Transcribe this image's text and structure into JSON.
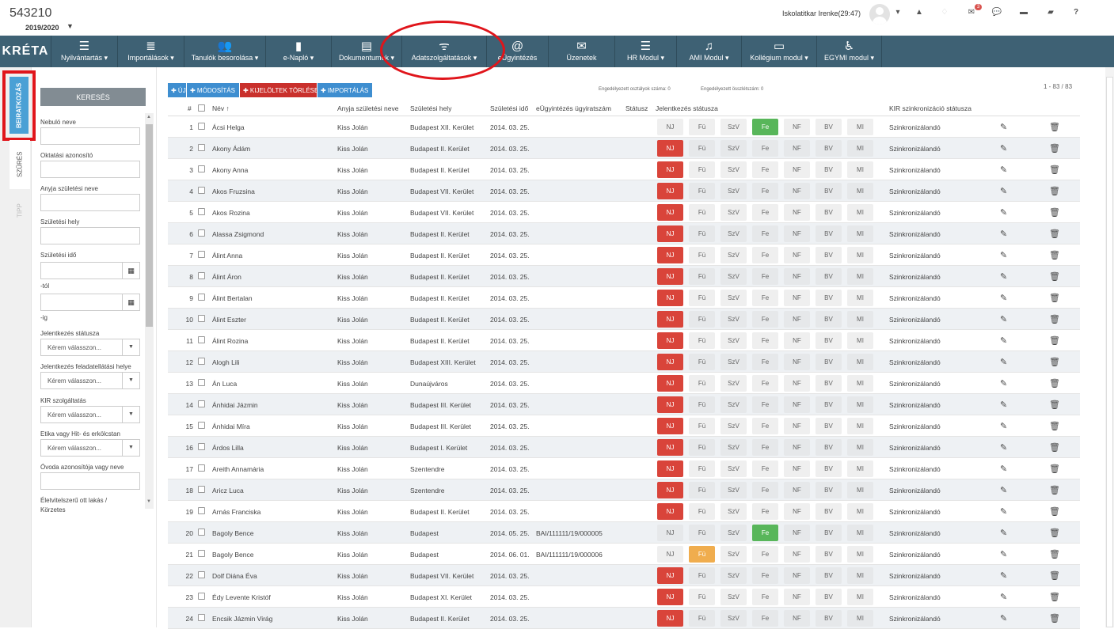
{
  "header": {
    "institution_code": "543210",
    "school_year": "2019/2020",
    "year_caret": "▼",
    "user_name": "Iskolatitkar Irenke(29:47)",
    "user_caret": "▾",
    "icons": {
      "warning": "▲",
      "bell": "♢",
      "mail": "✉",
      "chat": "💬",
      "card": "▬",
      "book": "▰",
      "help": "?"
    },
    "mail_badge": "3"
  },
  "nav": {
    "logo": "KRÉTA",
    "items": [
      {
        "label": "Nyilvántartás ▾",
        "icon": "☰"
      },
      {
        "label": "Importálások ▾",
        "icon": "≣"
      },
      {
        "label": "Tanulók besorolása ▾",
        "icon": "👥"
      },
      {
        "label": "e-Napló ▾",
        "icon": "▮"
      },
      {
        "label": "Dokumentumok ▾",
        "icon": "▤"
      },
      {
        "label": "Adatszolgáltatások ▾",
        "icon": "ᯤ"
      },
      {
        "label": "eÜgyintézés",
        "icon": "@"
      },
      {
        "label": "Üzenetek",
        "icon": "✉"
      },
      {
        "label": "HR Modul ▾",
        "icon": "☰"
      },
      {
        "label": "AMI Modul ▾",
        "icon": "♫"
      },
      {
        "label": "Kollégium modul ▾",
        "icon": "▭"
      },
      {
        "label": "EGYMI modul ▾",
        "icon": "♿"
      }
    ]
  },
  "side_tabs": {
    "beiratkozas": "BEIRATKOZÁS",
    "szures": "SZŰRÉS",
    "tipp": "TIPP"
  },
  "filters": {
    "search_button": "KERESÉS",
    "nebulo_neve": "Nebuló neve",
    "oktatasi_azonosito": "Oktatási azonosító",
    "anyja_szuletesi_neve": "Anyja születési neve",
    "szuletesi_hely": "Születési hely",
    "szuletesi_ido": "Születési idő",
    "tol": "-tól",
    "ig": "-ig",
    "jelentkezes_statusza": "Jelentkezés státusza",
    "feladatellatasi_hely": "Jelentkezés feladatellátási helye",
    "kir_szolgaltatas": "KIR szolgáltatás",
    "etika": "Etika vagy Hit- és erkölcstan",
    "ovoda": "Óvoda azonosítója vagy neve",
    "eletvitel": "Életvitelszerű ott lakás /",
    "eletvitel2": "Körzetes",
    "select_placeholder": "Kérem válasszon...",
    "caret": "▼",
    "calendar_icon": "▦"
  },
  "toolbar": {
    "new": "✚ ÚJ",
    "modify": "✚ MÓDOSÍTÁS",
    "delete_selected": "✚ KIJELÖLTEK TÖRLÉSE",
    "import": "✚ IMPORTÁLÁS",
    "allowed_classes": "Engedélyezett osztályok száma: 0",
    "allowed_total": "Engedélyezett összlétszám: 0",
    "paging": "1 - 83 / 83"
  },
  "grid": {
    "headers": {
      "num": "#",
      "name": "Név ↑",
      "mother": "Anyja születési neve",
      "birthplace": "Születési hely",
      "birthdate": "Születési idő",
      "case_no": "eÜgyintézés ügyiratszám",
      "status": "Státusz",
      "app_status": "Jelentkezés státusza",
      "kir": "KIR szinkronizáció státusza"
    },
    "status_labels": [
      "NJ",
      "Fü",
      "SzV",
      "Fe",
      "NF",
      "BV",
      "MI"
    ],
    "edit_icon": "✎",
    "delete_icon": "🗑",
    "rows": [
      {
        "n": "1",
        "name": "Ácsi Helga",
        "mother": "Kiss Jolán",
        "place": "Budapest XII. Kerület",
        "date": "2014. 03. 25.",
        "case": "",
        "active": 3,
        "kir": "Szinkronizálandó"
      },
      {
        "n": "2",
        "name": "Akony Ádám",
        "mother": "Kiss Jolán",
        "place": "Budapest II. Kerület",
        "date": "2014. 03. 25.",
        "case": "",
        "active": 0,
        "kir": "Szinkronizálandó"
      },
      {
        "n": "3",
        "name": "Akony Anna",
        "mother": "Kiss Jolán",
        "place": "Budapest II. Kerület",
        "date": "2014. 03. 25.",
        "case": "",
        "active": 0,
        "kir": "Szinkronizálandó"
      },
      {
        "n": "4",
        "name": "Akos Fruzsina",
        "mother": "Kiss Jolán",
        "place": "Budapest VII. Kerület",
        "date": "2014. 03. 25.",
        "case": "",
        "active": 0,
        "kir": "Szinkronizálandó"
      },
      {
        "n": "5",
        "name": "Akos Rozina",
        "mother": "Kiss Jolán",
        "place": "Budapest VII. Kerület",
        "date": "2014. 03. 25.",
        "case": "",
        "active": 0,
        "kir": "Szinkronizálandó"
      },
      {
        "n": "6",
        "name": "Alassa Zsigmond",
        "mother": "Kiss Jolán",
        "place": "Budapest II. Kerület",
        "date": "2014. 03. 25.",
        "case": "",
        "active": 0,
        "kir": "Szinkronizálandó"
      },
      {
        "n": "7",
        "name": "Álint Anna",
        "mother": "Kiss Jolán",
        "place": "Budapest II. Kerület",
        "date": "2014. 03. 25.",
        "case": "",
        "active": 0,
        "kir": "Szinkronizálandó"
      },
      {
        "n": "8",
        "name": "Álint Áron",
        "mother": "Kiss Jolán",
        "place": "Budapest II. Kerület",
        "date": "2014. 03. 25.",
        "case": "",
        "active": 0,
        "kir": "Szinkronizálandó"
      },
      {
        "n": "9",
        "name": "Álint Bertalan",
        "mother": "Kiss Jolán",
        "place": "Budapest II. Kerület",
        "date": "2014. 03. 25.",
        "case": "",
        "active": 0,
        "kir": "Szinkronizálandó"
      },
      {
        "n": "10",
        "name": "Álint Eszter",
        "mother": "Kiss Jolán",
        "place": "Budapest II. Kerület",
        "date": "2014. 03. 25.",
        "case": "",
        "active": 0,
        "kir": "Szinkronizálandó"
      },
      {
        "n": "11",
        "name": "Álint Rozina",
        "mother": "Kiss Jolán",
        "place": "Budapest II. Kerület",
        "date": "2014. 03. 25.",
        "case": "",
        "active": 0,
        "kir": "Szinkronizálandó"
      },
      {
        "n": "12",
        "name": "Alogh Lili",
        "mother": "Kiss Jolán",
        "place": "Budapest XIII. Kerület",
        "date": "2014. 03. 25.",
        "case": "",
        "active": 0,
        "kir": "Szinkronizálandó"
      },
      {
        "n": "13",
        "name": "Án Luca",
        "mother": "Kiss Jolán",
        "place": "Dunaújváros",
        "date": "2014. 03. 25.",
        "case": "",
        "active": 0,
        "kir": "Szinkronizálandó"
      },
      {
        "n": "14",
        "name": "Ánhidai Jázmin",
        "mother": "Kiss Jolán",
        "place": "Budapest III. Kerület",
        "date": "2014. 03. 25.",
        "case": "",
        "active": 0,
        "kir": "Szinkronizálandó"
      },
      {
        "n": "15",
        "name": "Ánhidai Míra",
        "mother": "Kiss Jolán",
        "place": "Budapest III. Kerület",
        "date": "2014. 03. 25.",
        "case": "",
        "active": 0,
        "kir": "Szinkronizálandó"
      },
      {
        "n": "16",
        "name": "Árdos Lilla",
        "mother": "Kiss Jolán",
        "place": "Budapest I. Kerület",
        "date": "2014. 03. 25.",
        "case": "",
        "active": 0,
        "kir": "Szinkronizálandó"
      },
      {
        "n": "17",
        "name": "Areith Annamária",
        "mother": "Kiss Jolán",
        "place": "Szentendre",
        "date": "2014. 03. 25.",
        "case": "",
        "active": 0,
        "kir": "Szinkronizálandó"
      },
      {
        "n": "18",
        "name": "Aricz Luca",
        "mother": "Kiss Jolán",
        "place": "Szentendre",
        "date": "2014. 03. 25.",
        "case": "",
        "active": 0,
        "kir": "Szinkronizálandó"
      },
      {
        "n": "19",
        "name": "Arnás Franciska",
        "mother": "Kiss Jolán",
        "place": "Budapest II. Kerület",
        "date": "2014. 03. 25.",
        "case": "",
        "active": 0,
        "kir": "Szinkronizálandó"
      },
      {
        "n": "20",
        "name": "Bagoly Bence",
        "mother": "Kiss Jolán",
        "place": "Budapest",
        "date": "2014. 05. 25.",
        "case": "BAI/111111/19/000005",
        "active": 3,
        "kir": "Szinkronizálandó"
      },
      {
        "n": "21",
        "name": "Bagoly Bence",
        "mother": "Kiss Jolán",
        "place": "Budapest",
        "date": "2014. 06. 01.",
        "case": "BAI/111111/19/000006",
        "active": 1,
        "kir": "Szinkronizálandó"
      },
      {
        "n": "22",
        "name": "Dolf Diána Éva",
        "mother": "Kiss Jolán",
        "place": "Budapest VII. Kerület",
        "date": "2014. 03. 25.",
        "case": "",
        "active": 0,
        "kir": "Szinkronizálandó"
      },
      {
        "n": "23",
        "name": "Édy Levente Kristóf",
        "mother": "Kiss Jolán",
        "place": "Budapest XI. Kerület",
        "date": "2014. 03. 25.",
        "case": "",
        "active": 0,
        "kir": "Szinkronizálandó"
      },
      {
        "n": "24",
        "name": "Encsik Jázmin Virág",
        "mother": "Kiss Jolán",
        "place": "Budapest II. Kerület",
        "date": "2014. 03. 25.",
        "case": "",
        "active": 0,
        "kir": "Szinkronizálandó"
      }
    ]
  },
  "colors": {
    "nav_bg": "#3e6174",
    "nj_red": "#d9443a",
    "fe_green": "#58b65a",
    "fu_orange": "#f0ad4e",
    "tab_blue": "#4aa0d5",
    "annotation_red": "#e0151b"
  }
}
